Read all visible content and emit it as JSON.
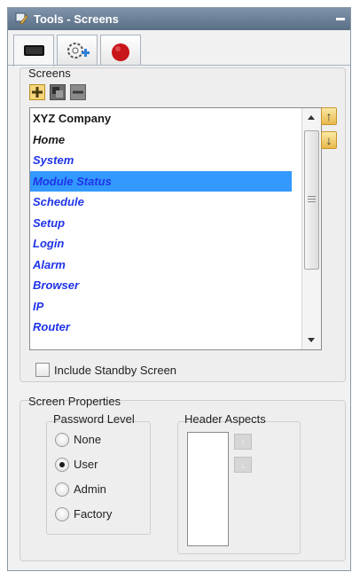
{
  "window": {
    "title": "Tools - Screens"
  },
  "screens": {
    "group_label": "Screens",
    "list": [
      {
        "label": "XYZ Company",
        "style": "plain"
      },
      {
        "label": "Home",
        "style": "dark"
      },
      {
        "label": "System",
        "style": "link"
      },
      {
        "label": "Module Status",
        "style": "selected"
      },
      {
        "label": "Schedule",
        "style": "link"
      },
      {
        "label": "Setup",
        "style": "link"
      },
      {
        "label": "Login",
        "style": "link"
      },
      {
        "label": "Alarm",
        "style": "link"
      },
      {
        "label": "Browser",
        "style": "link"
      },
      {
        "label": "IP",
        "style": "link"
      },
      {
        "label": "Router",
        "style": "link"
      }
    ],
    "include_standby_label": "Include Standby Screen",
    "include_standby_checked": false
  },
  "properties": {
    "group_label": "Screen Properties",
    "password_level": {
      "label": "Password Level",
      "options": [
        "None",
        "User",
        "Admin",
        "Factory"
      ],
      "selected": "User"
    },
    "header_aspects": {
      "label": "Header Aspects"
    }
  },
  "colors": {
    "link_text": "#1f33e8",
    "selection": "#3399ff",
    "titlebar": "#6b7f96"
  }
}
